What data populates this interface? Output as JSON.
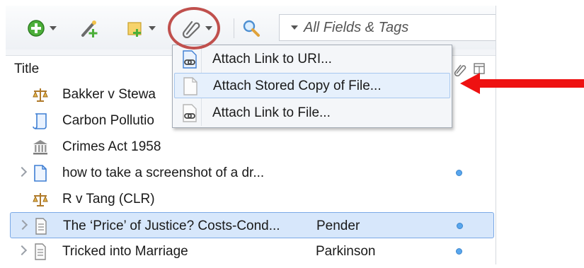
{
  "toolbar": {
    "search_placeholder": "All Fields & Tags",
    "icons": [
      "new-item-icon",
      "add-by-identifier-icon",
      "new-note-icon",
      "attachment-paperclip-icon",
      "search-icon"
    ]
  },
  "columns": {
    "title": "Title"
  },
  "menu": {
    "items": [
      {
        "label": "Attach Link to URI..."
      },
      {
        "label": "Attach Stored Copy of File..."
      },
      {
        "label": "Attach Link to File..."
      }
    ]
  },
  "items": [
    {
      "title": "Bakker v Stewa",
      "creator": "",
      "icon": "case-scales-icon",
      "expandable": false,
      "has_attachment": false
    },
    {
      "title": "Carbon Pollutio",
      "creator": "",
      "icon": "bill-scroll-icon",
      "expandable": false,
      "has_attachment": false
    },
    {
      "title": "Crimes Act 1958",
      "creator": "",
      "icon": "statute-building-icon",
      "expandable": false,
      "has_attachment": false
    },
    {
      "title": "how to take a screenshot of a dr...",
      "creator": "",
      "icon": "document-icon",
      "expandable": true,
      "has_attachment": true
    },
    {
      "title": "R v Tang (CLR)",
      "creator": "",
      "icon": "case-scales-icon",
      "expandable": false,
      "has_attachment": false
    },
    {
      "title": "The ‘Price’ of Justice? Costs-Cond...",
      "creator": "Pender",
      "icon": "journal-article-icon",
      "expandable": true,
      "has_attachment": true,
      "selected": true
    },
    {
      "title": "Tricked into Marriage",
      "creator": "Parkinson",
      "icon": "journal-article-icon",
      "expandable": true,
      "has_attachment": true
    }
  ],
  "colors": {
    "selection": "#d7e7fb",
    "annotation_circle": "#c0504d",
    "annotation_arrow": "#ee1111",
    "attachment_dot": "#58a6ee"
  }
}
